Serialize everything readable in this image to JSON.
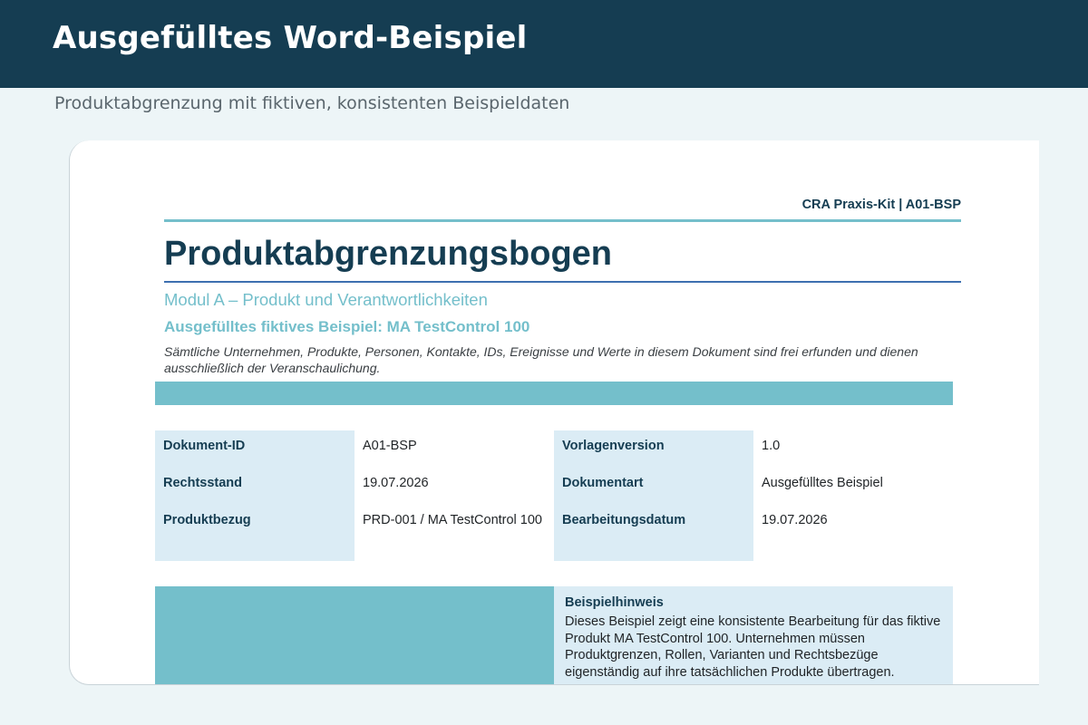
{
  "header": {
    "title": "Ausgefülltes Word-Beispiel",
    "subtitle": "Produktabgrenzung mit fiktiven, konsistenten Beispieldaten"
  },
  "document": {
    "running_header": "CRA Praxis-Kit | A01-BSP",
    "title": "Produktabgrenzungsbogen",
    "module": "Modul A – Produkt und Verantwortlichkeiten",
    "example_title": "Ausgefülltes fiktives Beispiel: MA TestControl 100",
    "disclaimer": "Sämtliche Unternehmen, Produkte, Personen, Kontakte, IDs, Ereignisse und Werte in diesem Dokument sind frei erfunden und dienen ausschließlich der Veranschaulichung.",
    "meta_left": [
      {
        "label": "Dokument-ID",
        "value": "A01-BSP"
      },
      {
        "label": "Rechtsstand",
        "value": "19.07.2026"
      },
      {
        "label": "Produktbezug",
        "value": "PRD-001 / MA TestControl 100"
      }
    ],
    "meta_right": [
      {
        "label": "Vorlagenversion",
        "value": "1.0"
      },
      {
        "label": "Dokumentart",
        "value": "Ausgefülltes Beispiel"
      },
      {
        "label": "Bearbeitungsdatum",
        "value": "19.07.2026"
      }
    ],
    "note": {
      "title": "Beispielhinweis",
      "text": "Dieses Beispiel zeigt eine konsistente Bearbeitung für das fiktive Produkt MA TestControl 100. Unternehmen müssen Produktgrenzen, Rollen, Varianten und Rechtsbezüge eigenständig auf ihre tatsächlichen Produkte übertragen."
    }
  },
  "colors": {
    "header_bg": "#153d52",
    "accent_teal": "#74bfcb",
    "label_bg": "#dbecf5",
    "title_rule": "#3d6fb0",
    "page_bg": "#edf5f7"
  }
}
